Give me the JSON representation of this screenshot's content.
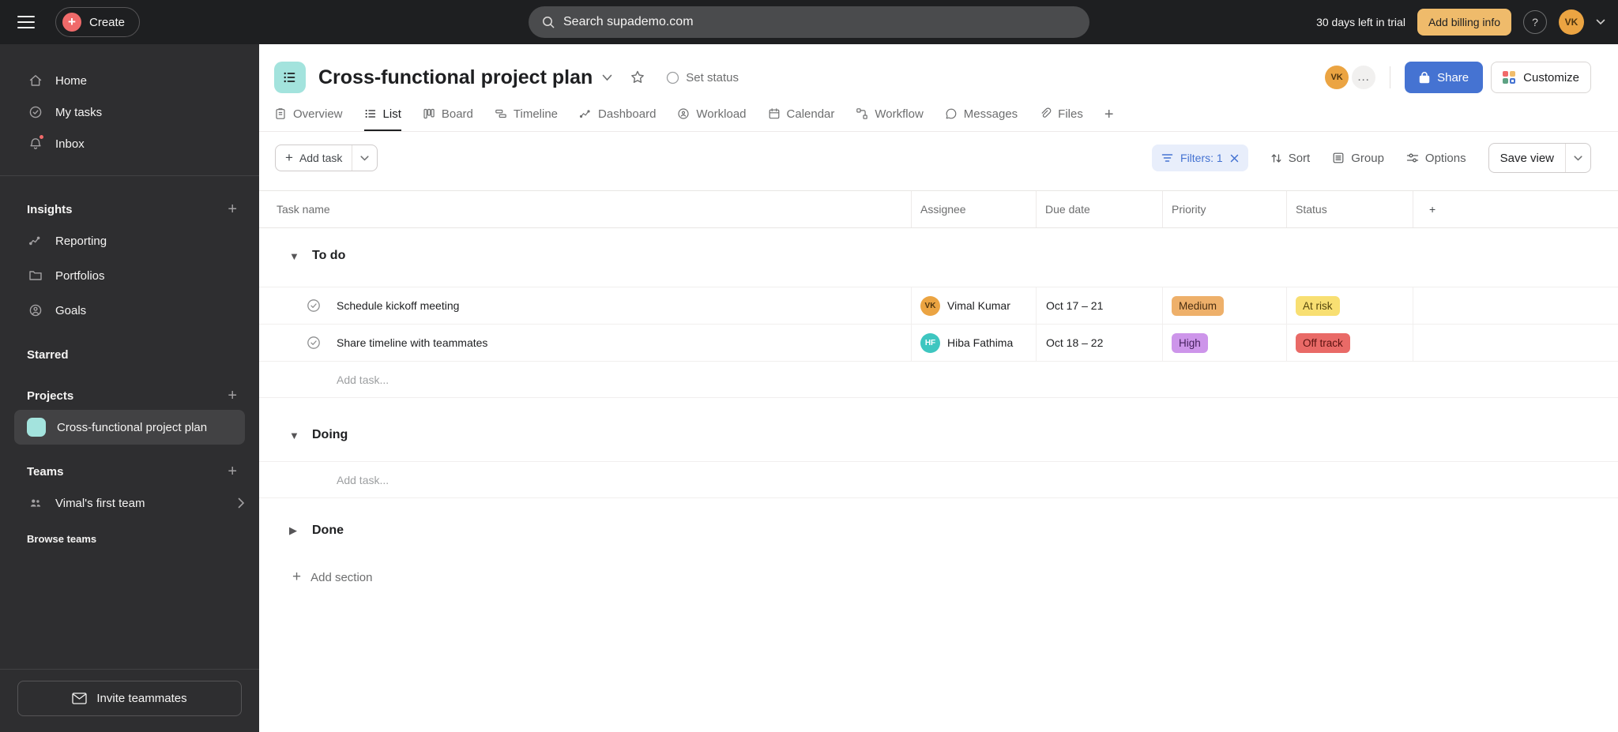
{
  "colors": {
    "topbar_bg": "#1e1f21",
    "sidebar_bg": "#2e2e30",
    "accent_blue": "#4573d2",
    "project_teal": "#a3e3dd",
    "alert_red": "#f06a6a",
    "billing_yellow": "#efbb6b"
  },
  "icons": {
    "hamburger-icon": "three bars",
    "search-icon": "magnifier",
    "help-icon": "?",
    "home-icon": "house",
    "my-tasks-icon": "check-circle",
    "inbox-icon": "bell with red dot",
    "reporting-icon": "line-chart",
    "portfolios-icon": "folder",
    "goals-icon": "person-in-circle",
    "team-icon": "two people",
    "envelope-icon": "envelope",
    "star-icon": "star outline",
    "lock-icon": "lock",
    "filter-icon": "three lines",
    "close-icon": "x",
    "sort-icon": "up-down arrows",
    "group-icon": "boxed list",
    "options-icon": "sliders",
    "chevron-down-icon": "v",
    "plus-icon": "+"
  },
  "topbar": {
    "create_label": "Create",
    "search_placeholder": "Search supademo.com",
    "trial_text": "30 days left in trial",
    "billing_label": "Add billing info",
    "help_label": "?",
    "avatar_initials": "VK"
  },
  "sidebar": {
    "nav": [
      {
        "label": "Home"
      },
      {
        "label": "My tasks"
      },
      {
        "label": "Inbox"
      }
    ],
    "insights": {
      "title": "Insights",
      "items": [
        {
          "label": "Reporting"
        },
        {
          "label": "Portfolios"
        },
        {
          "label": "Goals"
        }
      ]
    },
    "starred_title": "Starred",
    "projects": {
      "title": "Projects",
      "items": [
        {
          "label": "Cross-functional project plan",
          "color": "#a3e3dd"
        }
      ]
    },
    "teams": {
      "title": "Teams",
      "items": [
        {
          "label": "Vimal's first team"
        }
      ]
    },
    "browse_teams_label": "Browse teams",
    "invite_label": "Invite teammates"
  },
  "header": {
    "title": "Cross-functional project plan",
    "set_status_label": "Set status",
    "avatar_initials": "VK",
    "share_label": "Share",
    "customize_label": "Customize",
    "tabs": [
      {
        "label": "Overview"
      },
      {
        "label": "List",
        "active": true
      },
      {
        "label": "Board"
      },
      {
        "label": "Timeline"
      },
      {
        "label": "Dashboard"
      },
      {
        "label": "Workload"
      },
      {
        "label": "Calendar"
      },
      {
        "label": "Workflow"
      },
      {
        "label": "Messages"
      },
      {
        "label": "Files"
      }
    ]
  },
  "toolbar": {
    "add_task_label": "Add task",
    "filters_label": "Filters: 1",
    "sort_label": "Sort",
    "group_label": "Group",
    "options_label": "Options",
    "save_view_label": "Save view"
  },
  "table": {
    "columns": [
      "Task name",
      "Assignee",
      "Due date",
      "Priority",
      "Status"
    ],
    "sections": [
      {
        "name": "To do",
        "collapsed": false,
        "add_task_label": "Add task...",
        "tasks": [
          {
            "name": "Schedule kickoff meeting",
            "assignee": {
              "initials": "VK",
              "name": "Vimal Kumar",
              "bg": "#eba442",
              "fg": "#4f350f"
            },
            "due": "Oct 17 – 21",
            "priority": {
              "label": "Medium",
              "bg": "#eeb06a",
              "fg": "#4a2e11"
            },
            "status": {
              "label": "At risk",
              "bg": "#f8df72",
              "fg": "#57480d"
            }
          },
          {
            "name": "Share timeline with teammates",
            "assignee": {
              "initials": "HF",
              "name": "Hiba Fathima",
              "bg": "#3ec6c0",
              "fg": "#ffffff"
            },
            "due": "Oct 18 – 22",
            "priority": {
              "label": "High",
              "bg": "#cd95ea",
              "fg": "#45215e"
            },
            "status": {
              "label": "Off track",
              "bg": "#e96a67",
              "fg": "#5c1210"
            }
          }
        ]
      },
      {
        "name": "Doing",
        "collapsed": false,
        "add_task_label": "Add task...",
        "tasks": []
      },
      {
        "name": "Done",
        "collapsed": true,
        "tasks": []
      }
    ],
    "add_section_label": "Add section"
  }
}
